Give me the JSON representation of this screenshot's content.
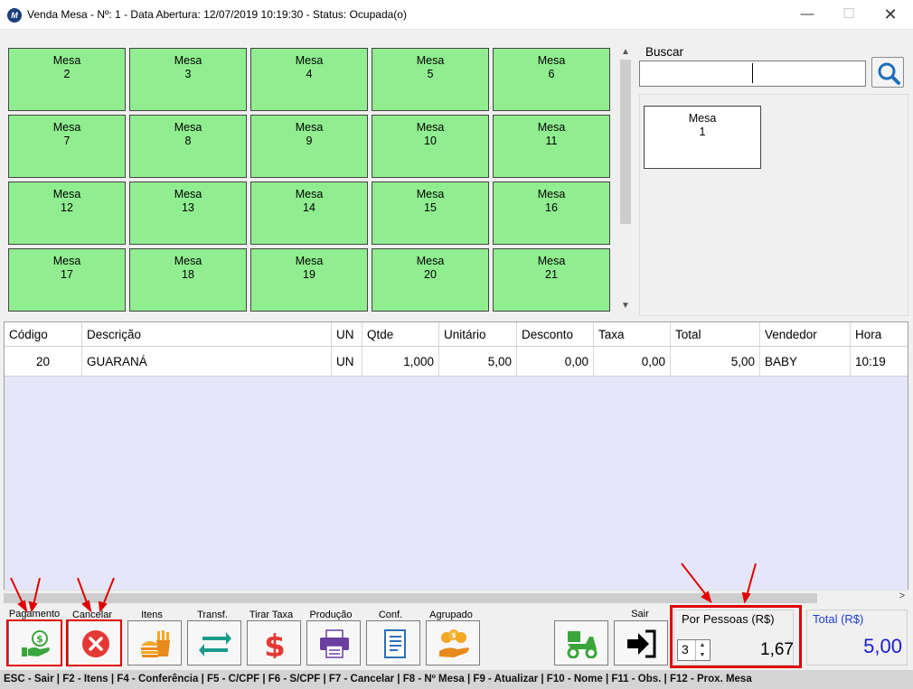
{
  "window": {
    "title": "Venda Mesa - Nº: 1 - Data Abertura: 12/07/2019 10:19:30 - Status: Ocupada(o)",
    "minimize": "—",
    "maximize": "☐",
    "close": "✕"
  },
  "tables": [
    {
      "label": "Mesa",
      "number": "2"
    },
    {
      "label": "Mesa",
      "number": "3"
    },
    {
      "label": "Mesa",
      "number": "4"
    },
    {
      "label": "Mesa",
      "number": "5"
    },
    {
      "label": "Mesa",
      "number": "6"
    },
    {
      "label": "Mesa",
      "number": "7"
    },
    {
      "label": "Mesa",
      "number": "8"
    },
    {
      "label": "Mesa",
      "number": "9"
    },
    {
      "label": "Mesa",
      "number": "10"
    },
    {
      "label": "Mesa",
      "number": "11"
    },
    {
      "label": "Mesa",
      "number": "12"
    },
    {
      "label": "Mesa",
      "number": "13"
    },
    {
      "label": "Mesa",
      "number": "14"
    },
    {
      "label": "Mesa",
      "number": "15"
    },
    {
      "label": "Mesa",
      "number": "16"
    },
    {
      "label": "Mesa",
      "number": "17"
    },
    {
      "label": "Mesa",
      "number": "18"
    },
    {
      "label": "Mesa",
      "number": "19"
    },
    {
      "label": "Mesa",
      "number": "20"
    },
    {
      "label": "Mesa",
      "number": "21"
    }
  ],
  "table_color": "#90ee90",
  "search": {
    "label": "Buscar",
    "value": "",
    "icon": "search-icon"
  },
  "occupied": {
    "label": "Mesa",
    "number": "1"
  },
  "items": {
    "columns": [
      "Código",
      "Descrição",
      "UN",
      "Qtde",
      "Unitário",
      "Desconto",
      "Taxa",
      "Total",
      "Vendedor",
      "Hora"
    ],
    "rows": [
      {
        "codigo": "20",
        "descricao": "GUARANÁ",
        "un": "UN",
        "qtde": "1,000",
        "unitario": "5,00",
        "desconto": "0,00",
        "taxa": "0,00",
        "total": "5,00",
        "vendedor": "BABY",
        "hora": "10:19"
      }
    ]
  },
  "toolbar": {
    "pagamento": "Pagamento",
    "cancelar": "Cancelar",
    "itens": "Itens",
    "transf": "Transf.",
    "tirar_taxa": "Tirar Taxa",
    "producao": "Produção",
    "conf": "Conf.",
    "agrupado": "Agrupado",
    "sair": "Sair"
  },
  "por_pessoas": {
    "label": "Por Pessoas (R$)",
    "count": "3",
    "value": "1,67"
  },
  "total": {
    "label": "Total (R$)",
    "value": "5,00"
  },
  "statusbar": "ESC - Sair | F2 - Itens | F4 - Conferência | F5 - C/CPF | F6 - S/CPF | F7 - Cancelar | F8 - Nº Mesa | F9 - Atualizar | F10 - Nome | F11 - Obs. | F12 - Prox. Mesa",
  "colors": {
    "accent_red": "#e00000",
    "total_blue": "#1c1cd0",
    "items_bg": "#e6e6fa"
  }
}
